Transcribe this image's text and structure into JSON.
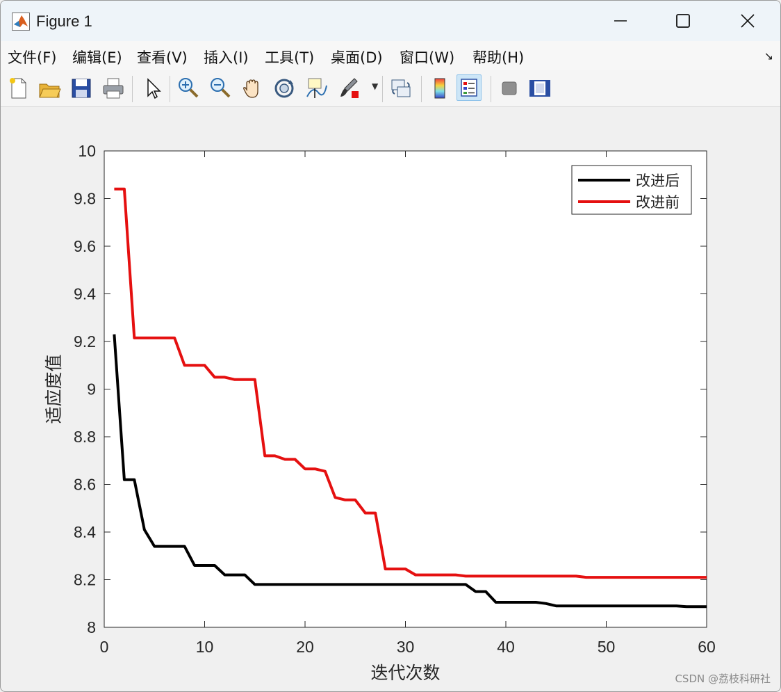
{
  "window": {
    "title": "Figure 1"
  },
  "menu": [
    "文件(F)",
    "编辑(E)",
    "查看(V)",
    "插入(I)",
    "工具(T)",
    "桌面(D)",
    "窗口(W)",
    "帮助(H)"
  ],
  "toolbar": [
    "new-figure-icon",
    "open-file-icon",
    "save-icon",
    "print-icon",
    "pointer-icon",
    "zoom-in-icon",
    "zoom-out-icon",
    "pan-icon",
    "rotate-3d-icon",
    "data-cursor-icon",
    "brush-icon",
    "link-plot-icon",
    "colorbar-icon",
    "legend-icon",
    "hide-plot-tools-icon",
    "show-plot-tools-icon"
  ],
  "watermark": "CSDN @荔枝科研社",
  "chart_data": {
    "type": "line",
    "xlabel": "迭代次数",
    "ylabel": "适应度值",
    "xlim": [
      0,
      60
    ],
    "ylim": [
      8,
      10
    ],
    "xticks": [
      "0",
      "10",
      "20",
      "30",
      "40",
      "50",
      "60"
    ],
    "yticks": [
      "8",
      "8.2",
      "8.4",
      "8.6",
      "8.8",
      "9",
      "9.2",
      "9.4",
      "9.6",
      "9.8",
      "10"
    ],
    "grid": false,
    "legend_position": "top-right",
    "series": [
      {
        "name": "改进后",
        "color": "#000000",
        "x": [
          1,
          2,
          3,
          4,
          5,
          6,
          7,
          8,
          9,
          10,
          11,
          12,
          13,
          14,
          15,
          16,
          17,
          18,
          19,
          20,
          21,
          22,
          23,
          24,
          25,
          26,
          27,
          28,
          29,
          30,
          31,
          32,
          33,
          34,
          35,
          36,
          37,
          38,
          39,
          40,
          41,
          42,
          43,
          44,
          45,
          46,
          47,
          48,
          49,
          50,
          51,
          52,
          53,
          54,
          55,
          56,
          57,
          58,
          59,
          60
        ],
        "y": [
          9.23,
          8.62,
          8.62,
          8.41,
          8.34,
          8.34,
          8.34,
          8.34,
          8.26,
          8.26,
          8.26,
          8.22,
          8.22,
          8.22,
          8.18,
          8.18,
          8.18,
          8.18,
          8.18,
          8.18,
          8.18,
          8.18,
          8.18,
          8.18,
          8.18,
          8.18,
          8.18,
          8.18,
          8.18,
          8.18,
          8.18,
          8.18,
          8.18,
          8.18,
          8.18,
          8.18,
          8.15,
          8.15,
          8.105,
          8.105,
          8.105,
          8.105,
          8.105,
          8.1,
          8.09,
          8.09,
          8.09,
          8.09,
          8.09,
          8.09,
          8.09,
          8.09,
          8.09,
          8.09,
          8.09,
          8.09,
          8.09,
          8.087,
          8.087,
          8.087
        ]
      },
      {
        "name": "改进前",
        "color": "#e51010",
        "x": [
          1,
          2,
          3,
          4,
          5,
          6,
          7,
          8,
          9,
          10,
          11,
          12,
          13,
          14,
          15,
          16,
          17,
          18,
          19,
          20,
          21,
          22,
          23,
          24,
          25,
          26,
          27,
          28,
          29,
          30,
          31,
          32,
          33,
          34,
          35,
          36,
          37,
          38,
          39,
          40,
          41,
          42,
          43,
          44,
          45,
          46,
          47,
          48,
          49,
          50,
          51,
          52,
          53,
          54,
          55,
          56,
          57,
          58,
          59,
          60
        ],
        "y": [
          9.84,
          9.84,
          9.215,
          9.215,
          9.215,
          9.215,
          9.215,
          9.1,
          9.1,
          9.1,
          9.05,
          9.05,
          9.04,
          9.04,
          9.04,
          8.72,
          8.72,
          8.705,
          8.705,
          8.665,
          8.665,
          8.655,
          8.545,
          8.535,
          8.535,
          8.48,
          8.48,
          8.245,
          8.245,
          8.245,
          8.22,
          8.22,
          8.22,
          8.22,
          8.22,
          8.215,
          8.215,
          8.215,
          8.215,
          8.215,
          8.215,
          8.215,
          8.215,
          8.215,
          8.215,
          8.215,
          8.215,
          8.21,
          8.21,
          8.21,
          8.21,
          8.21,
          8.21,
          8.21,
          8.21,
          8.21,
          8.21,
          8.21,
          8.21,
          8.21
        ]
      }
    ]
  }
}
